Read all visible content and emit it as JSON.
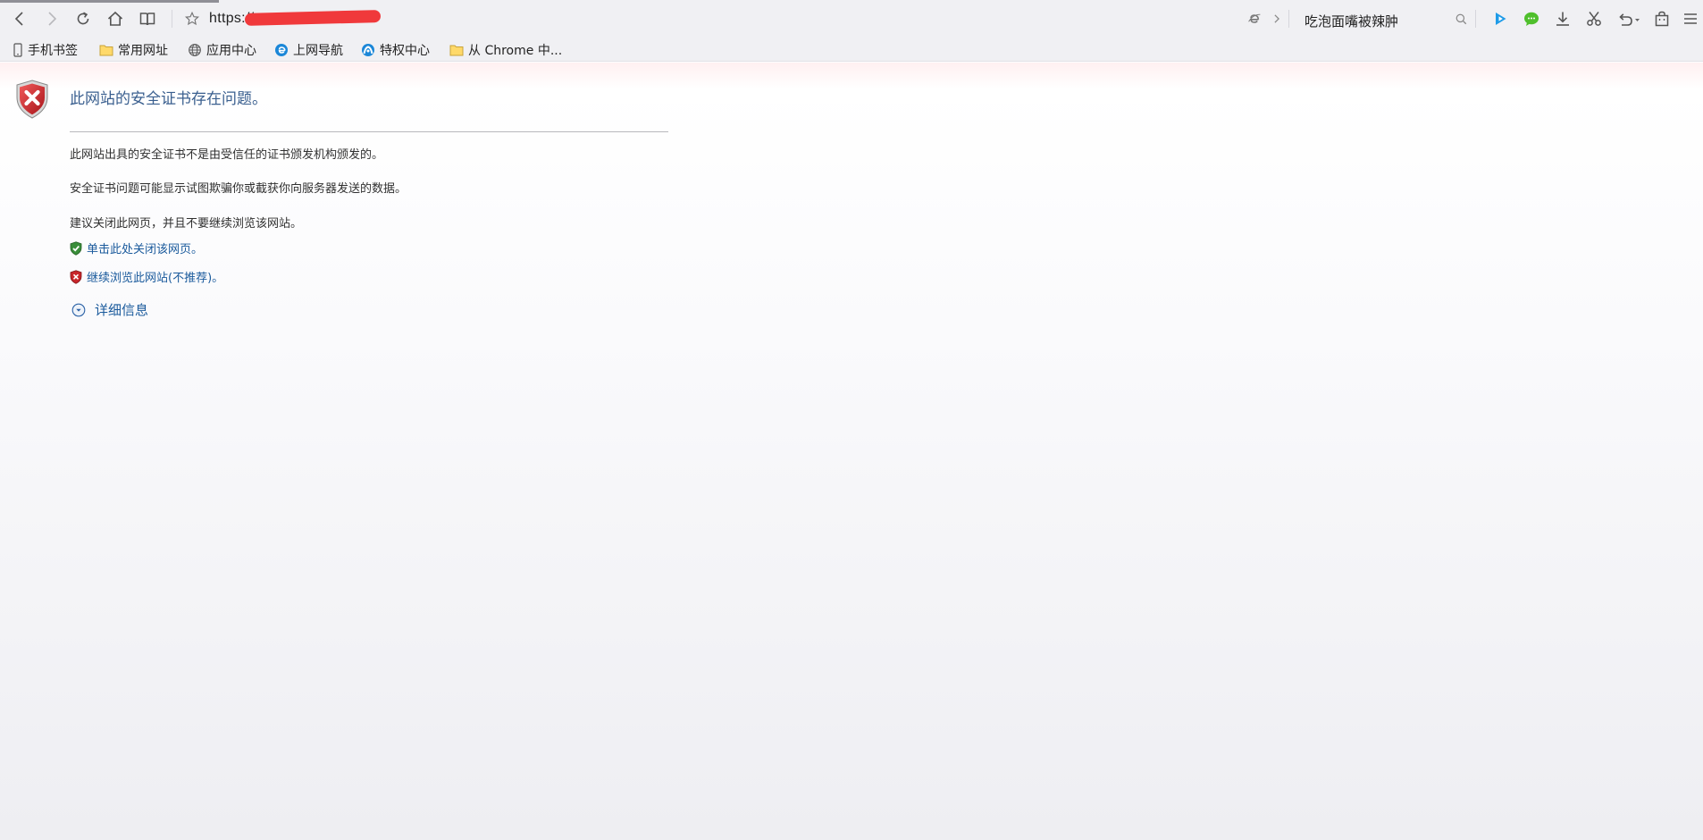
{
  "toolbar": {
    "url": "https://",
    "search_query": "吃泡面嘴被辣肿",
    "icons": {
      "back": "back-arrow-icon",
      "forward": "forward-arrow-icon",
      "reload": "reload-icon",
      "home": "home-icon",
      "reading": "reading-book-icon",
      "favorite": "star-icon",
      "ie_mode": "ie-mode-icon",
      "expand": "chevron-right-icon",
      "search": "magnifier-icon",
      "video": "play-icon",
      "chat": "chat-bubble-icon",
      "download": "download-icon",
      "screenshot": "scissors-icon",
      "undo": "undo-icon",
      "bag": "bag-icon",
      "menu": "hamburger-menu-icon"
    }
  },
  "bookmarks": {
    "items": [
      {
        "label": "手机书签",
        "icon": "phone-icon"
      },
      {
        "label": "常用网址",
        "icon": "folder-icon"
      },
      {
        "label": "应用中心",
        "icon": "globe-icon"
      },
      {
        "label": "上网导航",
        "icon": "ie-logo-icon"
      },
      {
        "label": "特权中心",
        "icon": "privilege-icon"
      },
      {
        "label": "从 Chrome 中...",
        "icon": "folder-icon"
      }
    ]
  },
  "error_page": {
    "title": "此网站的安全证书存在问题。",
    "paragraphs": [
      "此网站出具的安全证书不是由受信任的证书颁发机构颁发的。",
      "安全证书问题可能显示试图欺骗你或截获你向服务器发送的数据。",
      "建议关闭此网页，并且不要继续浏览该网站。"
    ],
    "close_link": "单击此处关闭该网页。",
    "continue_link": "继续浏览此网站(不推荐)。",
    "details": "详细信息"
  },
  "colors": {
    "shield_red": "#c8262b",
    "shield_green": "#3a8e3a",
    "link_blue": "#1a5a9c",
    "title_blue": "#3a5f8f",
    "redaction_red": "#f0393b"
  }
}
